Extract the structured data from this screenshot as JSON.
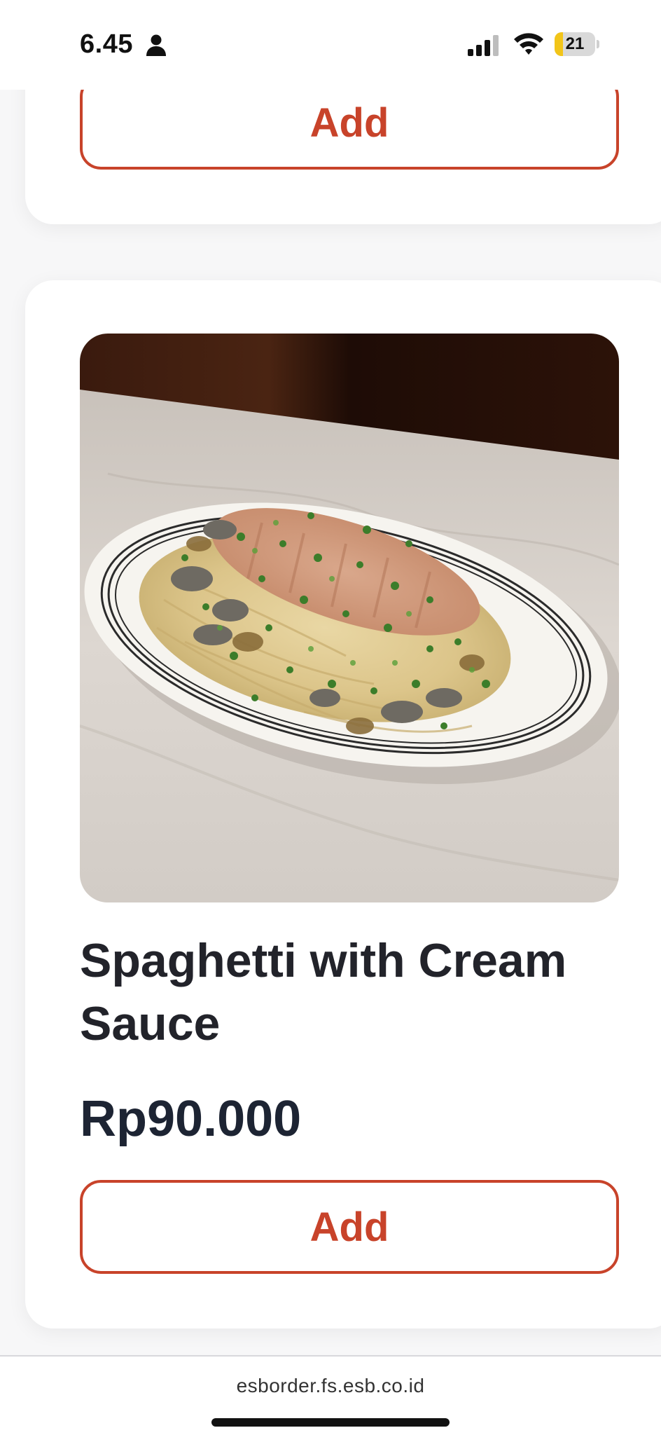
{
  "status_bar": {
    "time": "6.45",
    "battery_level": "21",
    "battery_fraction": 0.21,
    "icons": [
      "person-icon",
      "signal-icon",
      "wifi-icon",
      "battery-icon"
    ]
  },
  "previous_item": {
    "add_label": "Add"
  },
  "product": {
    "name": "Spaghetti with Cream Sauce",
    "price": "Rp90.000",
    "add_label": "Add",
    "image": "spaghetti-with-cream-sauce-photo"
  },
  "browser": {
    "url": "esborder.fs.esb.co.id"
  },
  "colors": {
    "accent": "#c8432a",
    "price_text": "#1d2433",
    "battery_yellow": "#f2c519"
  }
}
